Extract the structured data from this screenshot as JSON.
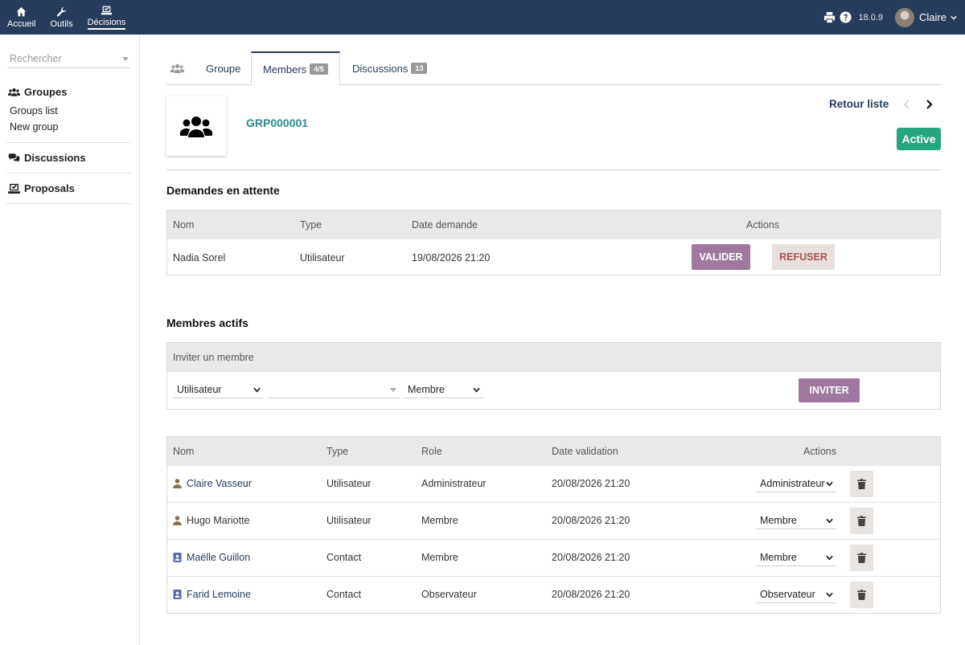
{
  "topnav": [
    {
      "label": "Accueil",
      "icon": "home-icon"
    },
    {
      "label": "Outils",
      "icon": "wrench-icon"
    },
    {
      "label": "Décisions",
      "icon": "vote-icon"
    }
  ],
  "topright": {
    "version": "18.0.9",
    "username": "Claire"
  },
  "sidebar": {
    "search_placeholder": "Rechercher",
    "groupes_title": "Groupes",
    "groupes_items": [
      "Groups list",
      "New group"
    ],
    "discussions_title": "Discussions",
    "proposals_title": "Proposals"
  },
  "tabs": {
    "groupe": "Groupe",
    "members": "Members",
    "members_badge": "4/5",
    "discussions": "Discussions",
    "discussions_badge": "13"
  },
  "header": {
    "ref": "GRP000001",
    "retour": "Retour liste",
    "status": "Active"
  },
  "colors": {
    "topbar": "#263c5c",
    "status": "#25a580",
    "primary_button": "#a0789f",
    "ref": "#2c8a8a"
  },
  "pending": {
    "title": "Demandes en attente",
    "headers": {
      "nom": "Nom",
      "type": "Type",
      "date": "Date demande",
      "actions": "Actions"
    },
    "rows": [
      {
        "nom": "Nadia Sorel",
        "type": "Utilisateur",
        "date": "19/08/2026 21:20",
        "validate": "VALIDER",
        "refuse": "REFUSER"
      }
    ]
  },
  "active": {
    "title": "Membres actifs",
    "invite_title": "Inviter un membre",
    "invite_type": "Utilisateur",
    "invite_who": "",
    "invite_role": "Membre",
    "invite_button": "INVITER",
    "headers": {
      "nom": "Nom",
      "type": "Type",
      "role": "Role",
      "date": "Date validation",
      "actions": "Actions"
    },
    "rows": [
      {
        "nom": "Claire Vasseur",
        "kind": "user",
        "type": "Utilisateur",
        "role": "Administrateur",
        "date": "20/08/2026 21:20",
        "role_select": "Administrateur"
      },
      {
        "nom": "Hugo Mariotte",
        "kind": "user",
        "type": "Utilisateur",
        "role": "Membre",
        "date": "20/08/2026 21:20",
        "role_select": "Membre"
      },
      {
        "nom": "Maëlle Guillon",
        "kind": "contact",
        "type": "Contact",
        "role": "Membre",
        "date": "20/08/2026 21:20",
        "role_select": "Membre"
      },
      {
        "nom": "Farid Lemoine",
        "kind": "contact",
        "type": "Contact",
        "role": "Observateur",
        "date": "20/08/2026 21:20",
        "role_select": "Observateur"
      }
    ]
  }
}
